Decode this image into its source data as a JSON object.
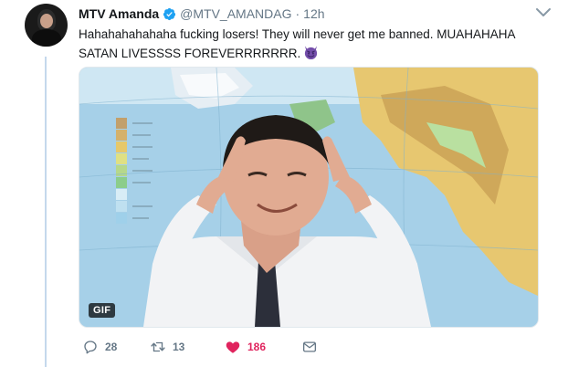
{
  "tweet": {
    "display_name": "MTV Amanda",
    "handle": "@MTV_AMANDAG",
    "separator": "·",
    "time": "12h",
    "text": "Hahahahahahaha fucking losers! They will never get me banned.  MUAHAHAHA SATAN LIVESSSS FOREVERRRRRRR.",
    "emoji": "smiling-face-with-horns",
    "media": {
      "type": "gif",
      "badge": "GIF"
    },
    "counts": {
      "replies": "28",
      "retweets": "13",
      "likes": "186"
    }
  },
  "colors": {
    "verified": "#1da1f2",
    "like": "#e0245e",
    "muted": "#657786",
    "thread_line": "#c4d8ec"
  }
}
